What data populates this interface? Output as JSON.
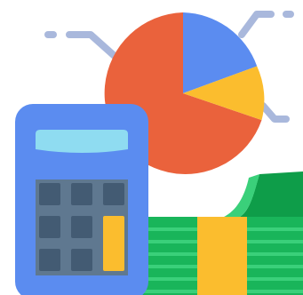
{
  "illustration": {
    "icons": [
      "calculator-icon",
      "pie-chart-icon",
      "money-stack-icon",
      "connector-lines"
    ],
    "colors": {
      "pie_blue": "#5b8cf0",
      "pie_orange": "#ea623c",
      "pie_yellow": "#fbbd2e",
      "calculator_body": "#5b8cf0",
      "calculator_screen": "#8fdcf1",
      "calculator_keypad": "#5f7890",
      "calculator_key": "#435b73",
      "calculator_accent_key": "#fbbd2e",
      "money_green": "#19b55a",
      "money_dark_green": "#0e9d49",
      "money_light_green": "#3ad07a",
      "money_band": "#fbbd2e",
      "connector": "#a9b8dc"
    }
  }
}
